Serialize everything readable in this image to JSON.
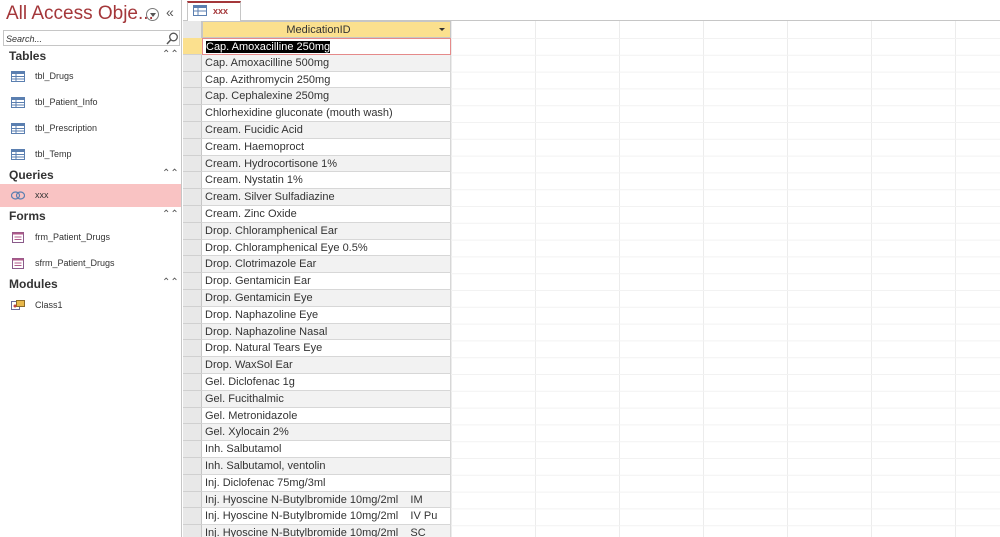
{
  "nav": {
    "title": "All Access Obje...",
    "search_placeholder": "Search...",
    "groups": {
      "tables": {
        "label": "Tables",
        "items": [
          "tbl_Drugs",
          "tbl_Patient_Info",
          "tbl_Prescription",
          "tbl_Temp"
        ]
      },
      "queries": {
        "label": "Queries",
        "items": [
          "xxx"
        ]
      },
      "forms": {
        "label": "Forms",
        "items": [
          "frm_Patient_Drugs",
          "sfrm_Patient_Drugs"
        ]
      },
      "modules": {
        "label": "Modules",
        "items": [
          "Class1"
        ]
      }
    }
  },
  "tab": {
    "label": "xxx"
  },
  "datasheet": {
    "column_header": "MedicationID",
    "rows": [
      "Cap. Amoxacilline 250mg",
      "Cap. Amoxacilline 500mg",
      "Cap. Azithromycin 250mg",
      "Cap. Cephalexine 250mg",
      "Chlorhexidine gluconate (mouth wash)",
      "Cream. Fucidic Acid",
      "Cream. Haemoproct",
      "Cream. Hydrocortisone 1%",
      "Cream. Nystatin 1%",
      "Cream. Silver Sulfadiazine",
      "Cream. Zinc Oxide",
      "Drop. Chloramphenical Ear",
      "Drop. Chloramphenical Eye 0.5%",
      "Drop. Clotrimazole Ear",
      "Drop. Gentamicin Ear",
      "Drop. Gentamicin Eye",
      "Drop. Naphazoline Eye",
      "Drop. Naphazoline Nasal",
      "Drop. Natural Tears Eye",
      "Drop. WaxSol Ear",
      "Gel. Diclofenac 1g",
      "Gel. Fucithalmic",
      "Gel. Metronidazole",
      "Gel. Xylocain 2%",
      "Inh. Salbutamol",
      "Inh. Salbutamol, ventolin",
      "Inj. Diclofenac 75mg/3ml",
      "Inj. Hyoscine N-Butylbromide 10mg/2ml    IM",
      "Inj. Hyoscine N-Butylbromide 10mg/2ml    IV Pu",
      "Inj. Hyoscine N-Butylbromide 10mg/2ml    SC"
    ]
  },
  "colors": {
    "accent": "#a4373a",
    "header_fill": "#fbe08e",
    "selected_item": "#f9c3c3"
  }
}
